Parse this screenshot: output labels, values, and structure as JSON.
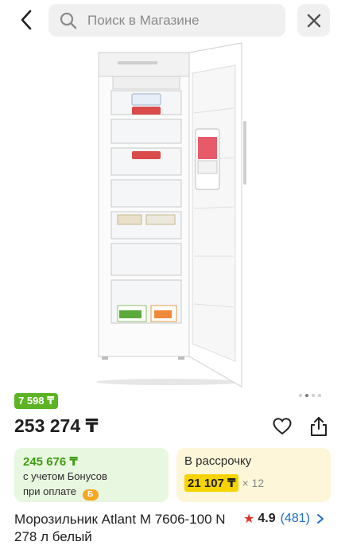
{
  "header": {
    "search_placeholder": "Поиск в Магазине"
  },
  "gallery": {
    "image_subject": "Морозильник Atlant М 7606-100 N (white upright freezer, door open)",
    "dots_count": 4,
    "active_dot": 2
  },
  "pricing": {
    "bonus_badge": "7 598 ₸",
    "price": "253 274 ₸"
  },
  "bonus_card": {
    "amount": "245 676 ₸",
    "note_line1": "с учетом Бонусов",
    "note_line2": "при оплате",
    "coin_label": "Б"
  },
  "installment_card": {
    "title": "В рассрочку",
    "monthly": "21 107 ₸",
    "times": "× 12"
  },
  "product": {
    "name": "Морозильник Atlant М 7606-100 N 278 л белый",
    "rating": "4.9",
    "reviews": "(481)"
  },
  "colors": {
    "accent_green": "#5cb324",
    "installment_yellow": "#f6d400",
    "rating_star": "#e0352b",
    "link_blue": "#1e6dc9"
  }
}
